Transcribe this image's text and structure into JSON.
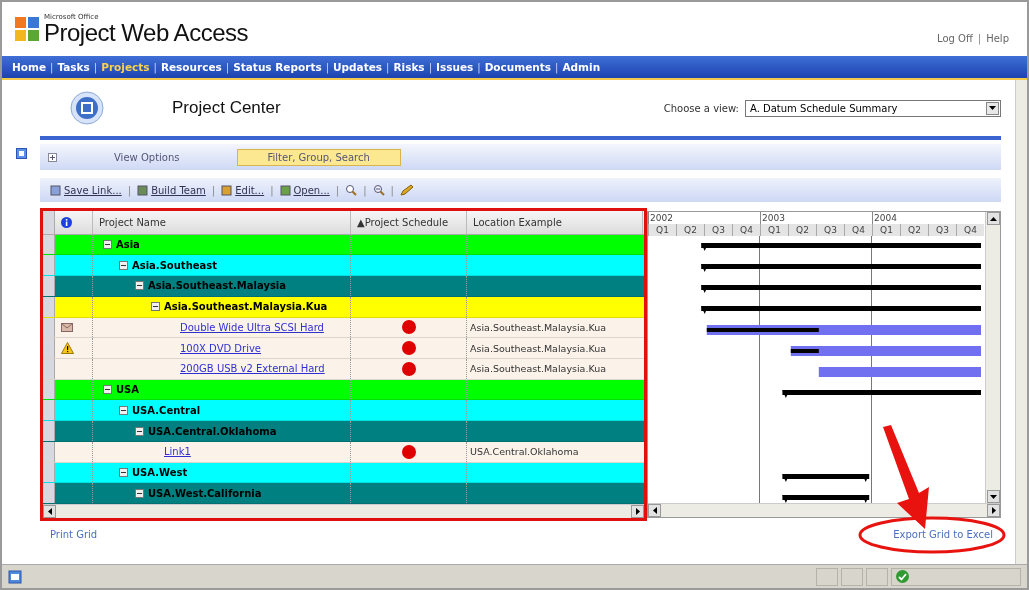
{
  "header": {
    "suite": "Microsoft Office",
    "product": "Project Web Access",
    "links": [
      "Log Off",
      "Help"
    ],
    "separator": "|"
  },
  "nav": {
    "separator": "|",
    "items": [
      {
        "label": "Home",
        "selected": false
      },
      {
        "label": "Tasks",
        "selected": false
      },
      {
        "label": "Projects",
        "selected": true
      },
      {
        "label": "Resources",
        "selected": false
      },
      {
        "label": "Status Reports",
        "selected": false
      },
      {
        "label": "Updates",
        "selected": false
      },
      {
        "label": "Risks",
        "selected": false
      },
      {
        "label": "Issues",
        "selected": false
      },
      {
        "label": "Documents",
        "selected": false
      },
      {
        "label": "Admin",
        "selected": false
      }
    ]
  },
  "page": {
    "title": "Project Center",
    "view_label": "Choose a view:",
    "view_value": "A. Datum Schedule Summary"
  },
  "view_tabs": [
    {
      "label": "View Options",
      "selected": false
    },
    {
      "label": "Filter, Group, Search",
      "selected": true
    }
  ],
  "toolbar": {
    "separator": "|",
    "items": [
      "Save Link...",
      "Build Team",
      "Edit...",
      "Open..."
    ]
  },
  "grid": {
    "columns": [
      {
        "label": "Project Name"
      },
      {
        "label": "▲Project Schedule"
      },
      {
        "label": "Location Example"
      }
    ],
    "rows": [
      {
        "kind": "group",
        "name": "Asia",
        "color": "#00ff00",
        "expanded": true,
        "children": [
          {
            "kind": "group",
            "name": "Asia.Southeast",
            "color": "#00ffff",
            "expanded": true,
            "children": [
              {
                "kind": "group",
                "name": "Asia.Southeast.Malaysia",
                "color": "#008080",
                "expanded": true,
                "children": [
                  {
                    "kind": "group",
                    "name": "Asia.Southeast.Malaysia.Kua",
                    "color": "#ffff00",
                    "expanded": true,
                    "children": [
                      {
                        "kind": "task",
                        "name": "Double Wide Ultra SCSI Hard",
                        "note": true,
                        "warning": false,
                        "color": "#e00000",
                        "location": "Asia.Southeast.Malaysia.Kua"
                      },
                      {
                        "kind": "task",
                        "name": "100X DVD Drive",
                        "note": false,
                        "warning": true,
                        "color": "#e00000",
                        "location": "Asia.Southeast.Malaysia.Kua"
                      },
                      {
                        "kind": "task",
                        "name": "200GB USB v2 External Hard",
                        "note": false,
                        "warning": false,
                        "color": "#e00000",
                        "location": "Asia.Southeast.Malaysia.Kua"
                      }
                    ]
                  }
                ]
              }
            ]
          }
        ]
      },
      {
        "kind": "group",
        "name": "USA",
        "color": "#00ff00",
        "expanded": true,
        "children": [
          {
            "kind": "group",
            "name": "USA.Central",
            "color": "#00ffff",
            "expanded": true,
            "children": [
              {
                "kind": "group",
                "name": "USA.Central.Oklahoma",
                "color": "#008080",
                "expanded": true,
                "children": [
                  {
                    "kind": "task",
                    "name": "Link1",
                    "note": false,
                    "warning": false,
                    "color": "#e00000",
                    "location": "USA.Central.Oklahoma"
                  }
                ]
              }
            ]
          },
          {
            "kind": "group",
            "name": "USA.West",
            "color": "#00ffff",
            "expanded": true,
            "children": [
              {
                "kind": "group",
                "name": "USA.West.California",
                "color": "#008080",
                "expanded": true
              }
            ]
          }
        ]
      }
    ]
  },
  "gantt": {
    "years": [
      "2002",
      "2003",
      "2004"
    ],
    "quarters": [
      "Q1",
      "Q2",
      "Q3",
      "Q4",
      "Q1",
      "Q2",
      "Q3",
      "Q4",
      "Q1",
      "Q2",
      "Q3",
      "Q4"
    ]
  },
  "footer": {
    "print": "Print Grid",
    "export": "Export Grid to Excel"
  }
}
